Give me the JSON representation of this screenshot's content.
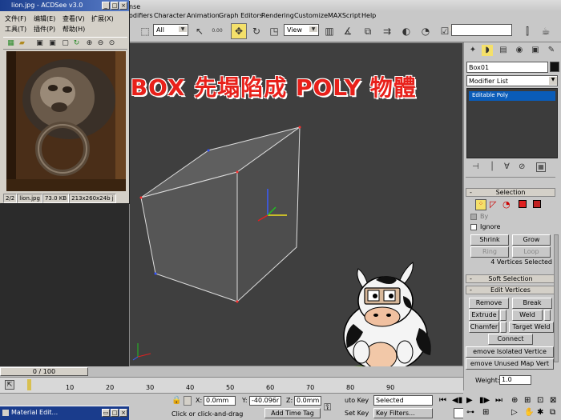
{
  "max_menu": [
    "odifiers",
    "Character",
    "Animation",
    "Graph Editors",
    "Rendering",
    "Customize",
    "MAXScript",
    "Help"
  ],
  "max_title_frag": "nse",
  "toolbar": {
    "filter_dropdown": "All",
    "refcoord_dropdown": "View",
    "spin_label": "0.00"
  },
  "acdsee": {
    "title": "lion.jpg - ACDSee v3.0",
    "menu": [
      "文件(F)",
      "编辑(E)",
      "查看(V)",
      "扩展(X)",
      "工具(T)",
      "插件(P)",
      "帮助(H)"
    ],
    "status": {
      "index": "2/2",
      "file": "lion.jpg",
      "size": "73.0 KB",
      "dims": "213x260x24b j"
    }
  },
  "caption": "建個 BOX 先塌陷成 POLY 物體",
  "panel": {
    "object_name": "Box01",
    "object_color": "#101010",
    "modifier_list": "Modifier List",
    "stack_item": "Editable Poly",
    "selection_title": "Selection",
    "by_label": "By",
    "ignore_label": "Ignore",
    "shrink": "Shrink",
    "grow": "Grow",
    "ring": "Ring",
    "loop": "Loop",
    "sel_status": "4 Vertices Selected",
    "soft_selection": "Soft Selection",
    "edit_vertices": "Edit Vertices",
    "remove": "Remove",
    "break": "Break",
    "extrude": "Extrude",
    "weld": "Weld",
    "chamfer": "Chamfer",
    "target_weld": "Target Weld",
    "connect": "Connect",
    "remove_isolated": "emove Isolated Vertice",
    "remove_unused": "emove Unused Map Vert",
    "weight_label": "Weight:",
    "weight_value": "1.0"
  },
  "timeline": {
    "frame": "0 / 100",
    "ticks": [
      "10",
      "20",
      "30",
      "40",
      "50",
      "60",
      "70",
      "80",
      "90"
    ]
  },
  "status": {
    "x_label": "X:",
    "x_value": "0.0mm",
    "y_label": "Y:",
    "y_value": "-40.096r",
    "z_label": "Z:",
    "z_value": "0.0mm",
    "prompt": "Click or click-and-drag",
    "add_time_tag": "Add Time Tag",
    "auto_key": "uto Key",
    "selected": "Selected",
    "set_key": "Set Key",
    "key_filters": "Key Filters...",
    "frame_value": "0"
  },
  "taskbar": {
    "item": "Material Edit..."
  },
  "colors": {
    "accent_red": "#e8201a",
    "stack_highlight": "#0a5cb8",
    "viewport_bg": "#3f3f3f"
  }
}
